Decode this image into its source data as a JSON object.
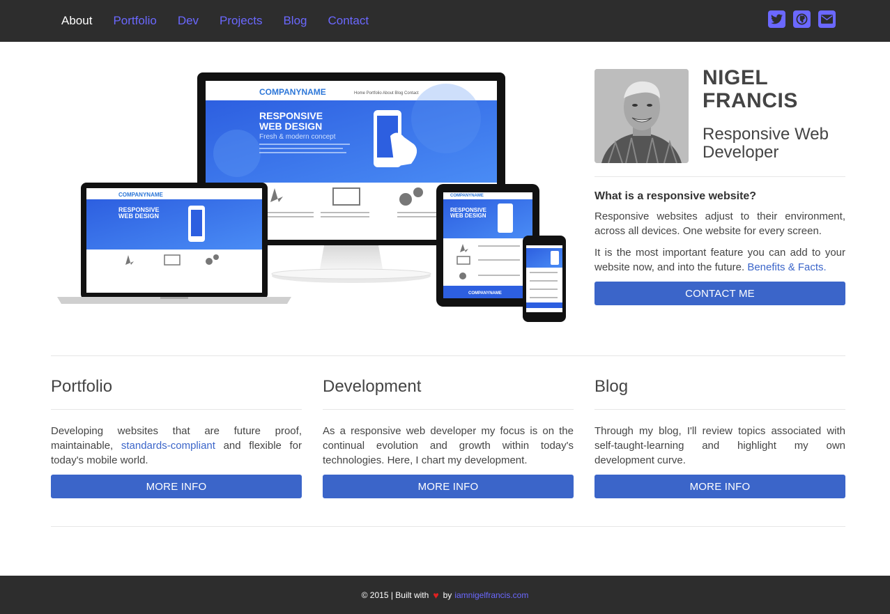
{
  "nav": {
    "items": [
      {
        "label": "About",
        "active": true
      },
      {
        "label": "Portfolio",
        "active": false
      },
      {
        "label": "Dev",
        "active": false
      },
      {
        "label": "Projects",
        "active": false
      },
      {
        "label": "Blog",
        "active": false
      },
      {
        "label": "Contact",
        "active": false
      }
    ],
    "social_icons": [
      "twitter-icon",
      "github-icon",
      "envelope-icon"
    ]
  },
  "hero": {
    "devices_image": {
      "brand": "COMPANYNAME",
      "menu": [
        "Home",
        "Portfolio",
        "About",
        "Blog",
        "Contact"
      ],
      "headline_1": "RESPONSIVE",
      "headline_2": "WEB DESIGN",
      "tagline": "Fresh & modern concept"
    },
    "name_line1": "NIGEL",
    "name_line2": "FRANCIS",
    "role": "Responsive Web Developer",
    "question": "What is a responsive website?",
    "para1": "Responsive websites adjust to their environment, across all devices. One website for every screen.",
    "para2_text": "It is the most important feature you can add to your website now, and into the future.",
    "para2_link": "Benefits & Facts.",
    "contact_button": "CONTACT ME"
  },
  "columns": [
    {
      "title": "Portfolio",
      "text_before": "Developing websites that are future proof, maintainable,",
      "link": "standards-compliant",
      "text_after": "and flexible for today's mobile world.",
      "button": "MORE INFO"
    },
    {
      "title": "Development",
      "text_before": "As a responsive web developer my focus is on the continual evolution and growth within today's technologies. Here, I chart my development.",
      "link": "",
      "text_after": "",
      "button": "MORE INFO"
    },
    {
      "title": "Blog",
      "text_before": "Through my blog, I'll review topics associated with self-taught-learning and highlight my own development curve.",
      "link": "",
      "text_after": "",
      "button": "MORE INFO"
    }
  ],
  "footer": {
    "copyright": "© 2015  |  Built with",
    "heart": "♥",
    "by": "by",
    "link": "iamnigelfrancis.com"
  },
  "colors": {
    "nav_bg": "#2d2d2d",
    "nav_link": "#6b68ff",
    "button": "#3b65c9",
    "link": "#3b65c9"
  }
}
